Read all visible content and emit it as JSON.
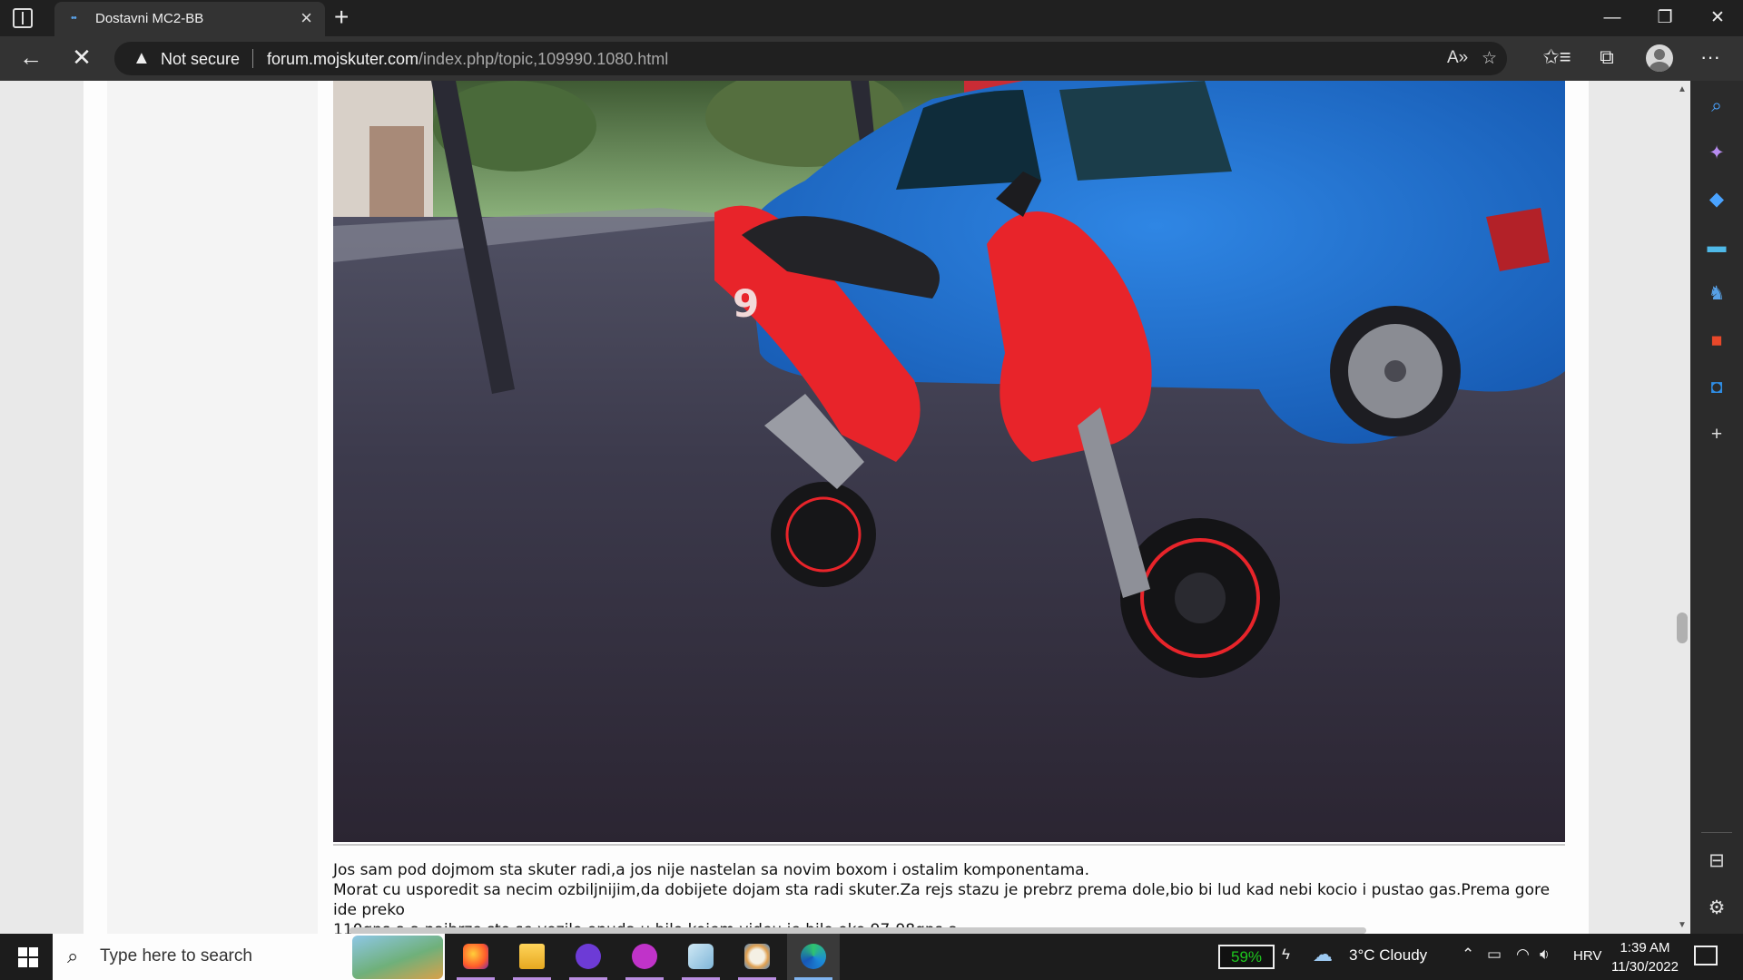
{
  "browser": {
    "tab_title": "Dostavni MC2-BB",
    "security_label": "Not secure",
    "url_host": "forum.mojskuter.com",
    "url_path": "/index.php/topic,109990.1080.html"
  },
  "post": {
    "line1": "Jos sam pod dojmom sta skuter radi,a jos nije nastelan sa novim boxom i ostalim komponentama.",
    "line2": "Morat cu usporedit sa necim ozbiljnijim,da dobijete dojam sta radi skuter.Za rejs stazu je prebrz prema dole,bio bi lud kad nebi kocio i pustao gas.Prema gore ide preko",
    "line3": "110gps-a,a najbrze sto se vozilo onuda u bilo kojem videu je bilo oko 97-98gps-a.",
    "image_alt": "Red scooter with number 9 parked next to a blue car"
  },
  "taskbar": {
    "search_placeholder": "Type here to search",
    "battery": "59%",
    "weather": "3°C  Cloudy",
    "language": "HRV",
    "time": "1:39 AM",
    "date": "11/30/2022"
  },
  "colors": {
    "scooter_red": "#e8242a",
    "car_blue": "#1f6fcf",
    "battery_green": "#1ec61e"
  }
}
